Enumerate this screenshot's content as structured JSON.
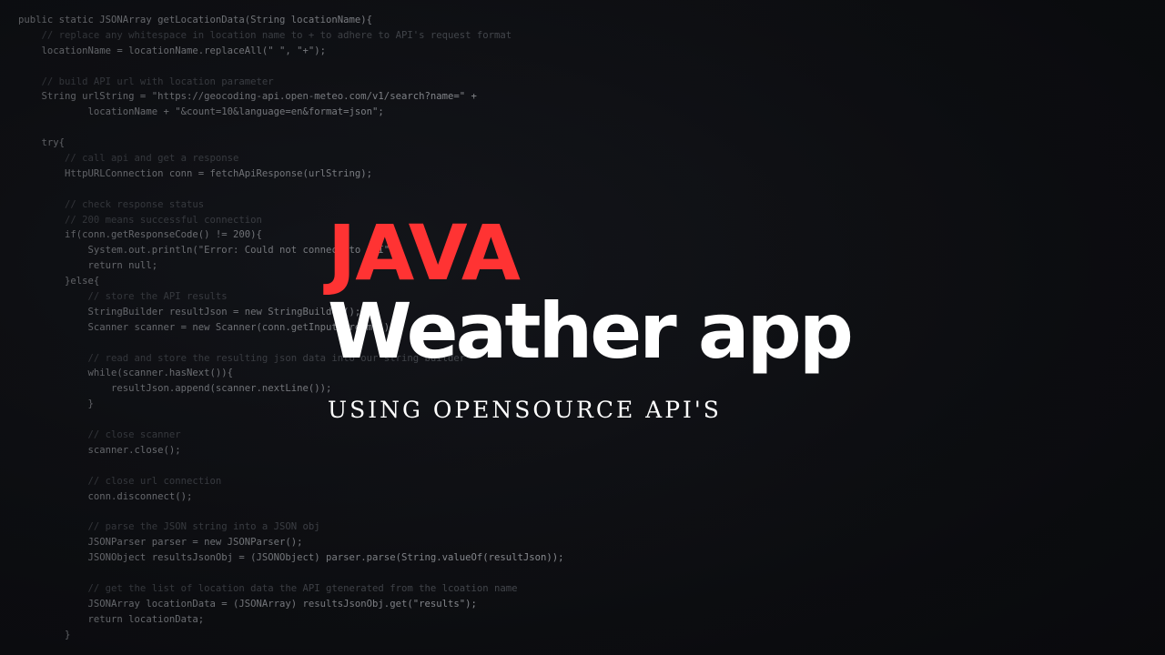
{
  "code": {
    "lines": [
      "public static JSONArray getLocationData(String locationName){",
      "    // replace any whitespace in location name to + to adhere to API's request format",
      "    locationName = locationName.replaceAll(\" \", \"+\");",
      "",
      "    // build API url with location parameter",
      "    String urlString = \"https://geocoding-api.open-meteo.com/v1/search?name=\" +",
      "            locationName + \"&count=10&language=en&format=json\";",
      "",
      "    try{",
      "        // call api and get a response",
      "        HttpURLConnection conn = fetchApiResponse(urlString);",
      "",
      "        // check response status",
      "        // 200 means successful connection",
      "        if(conn.getResponseCode() != 200){",
      "            System.out.println(\"Error: Could not connect to API\");",
      "            return null;",
      "        }else{",
      "            // store the API results",
      "            StringBuilder resultJson = new StringBuilder();",
      "            Scanner scanner = new Scanner(conn.getInputStream());",
      "",
      "            // read and store the resulting json data into our string builder",
      "            while(scanner.hasNext()){",
      "                resultJson.append(scanner.nextLine());",
      "            }",
      "",
      "            // close scanner",
      "            scanner.close();",
      "",
      "            // close url connection",
      "            conn.disconnect();",
      "",
      "            // parse the JSON string into a JSON obj",
      "            JSONParser parser = new JSONParser();",
      "            JSONObject resultsJsonObj = (JSONObject) parser.parse(String.valueOf(resultJson));",
      "",
      "            // get the list of location data the API gtenerated from the lcoation name",
      "            JSONArray locationData = (JSONArray) resultsJsonObj.get(\"results\");",
      "            return locationData;",
      "        }"
    ]
  },
  "title": {
    "line1": "JAVA",
    "line2": "Weather app",
    "subtitle": "USING OPENSOURCE API'S"
  },
  "colors": {
    "accent": "#ff3333",
    "text": "#ffffff",
    "background": "#0b0c10"
  }
}
